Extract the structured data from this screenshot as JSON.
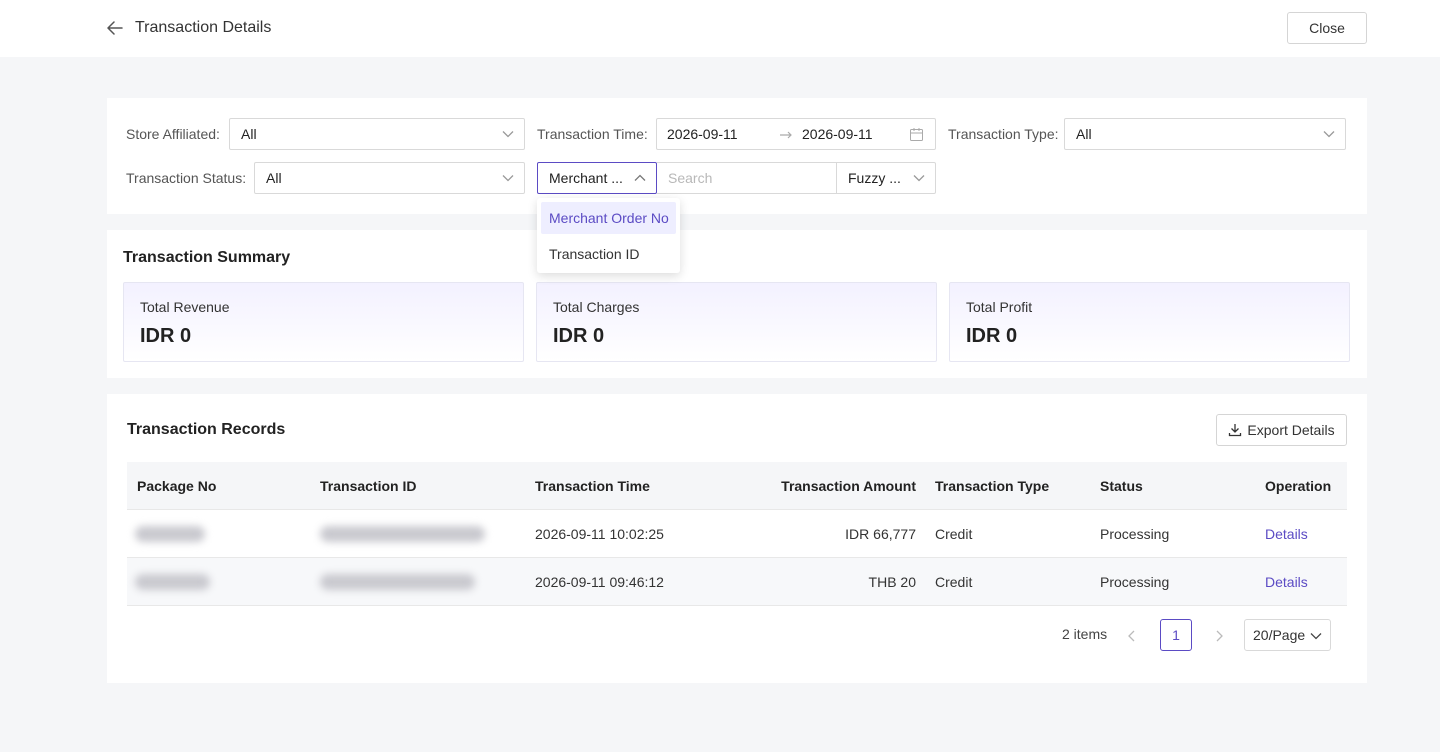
{
  "header": {
    "title": "Transaction Details",
    "close_label": "Close"
  },
  "filters": {
    "store_label": "Store Affiliated:",
    "store_value": "All",
    "time_label": "Transaction Time:",
    "time_start": "2026-09-11",
    "time_end": "2026-09-11",
    "type_label": "Transaction Type:",
    "type_value": "All",
    "status_label": "Transaction Status:",
    "status_value": "All",
    "field_select_value": "Merchant ...",
    "search_placeholder": "Search",
    "match_select_value": "Fuzzy ...",
    "field_options": [
      "Merchant Order No",
      "Transaction ID"
    ]
  },
  "summary": {
    "title": "Transaction Summary",
    "cards": [
      {
        "label": "Total Revenue",
        "value": "IDR 0"
      },
      {
        "label": "Total Charges",
        "value": "IDR 0"
      },
      {
        "label": "Total Profit",
        "value": "IDR 0"
      }
    ]
  },
  "records": {
    "title": "Transaction Records",
    "export_label": "Export Details",
    "columns": [
      "Package No",
      "Transaction ID",
      "Transaction Time",
      "Transaction Amount",
      "Transaction Type",
      "Status",
      "Operation"
    ],
    "rows": [
      {
        "time": "2026-09-11 10:02:25",
        "amount": "IDR 66,777",
        "type": "Credit",
        "status": "Processing",
        "operation": "Details"
      },
      {
        "time": "2026-09-11 09:46:12",
        "amount": "THB 20",
        "type": "Credit",
        "status": "Processing",
        "operation": "Details"
      }
    ]
  },
  "pagination": {
    "total": "2 items",
    "current_page": "1",
    "page_size": "20/Page"
  },
  "colors": {
    "accent": "#5b4bc4",
    "accent_bg": "#eeeeff"
  }
}
